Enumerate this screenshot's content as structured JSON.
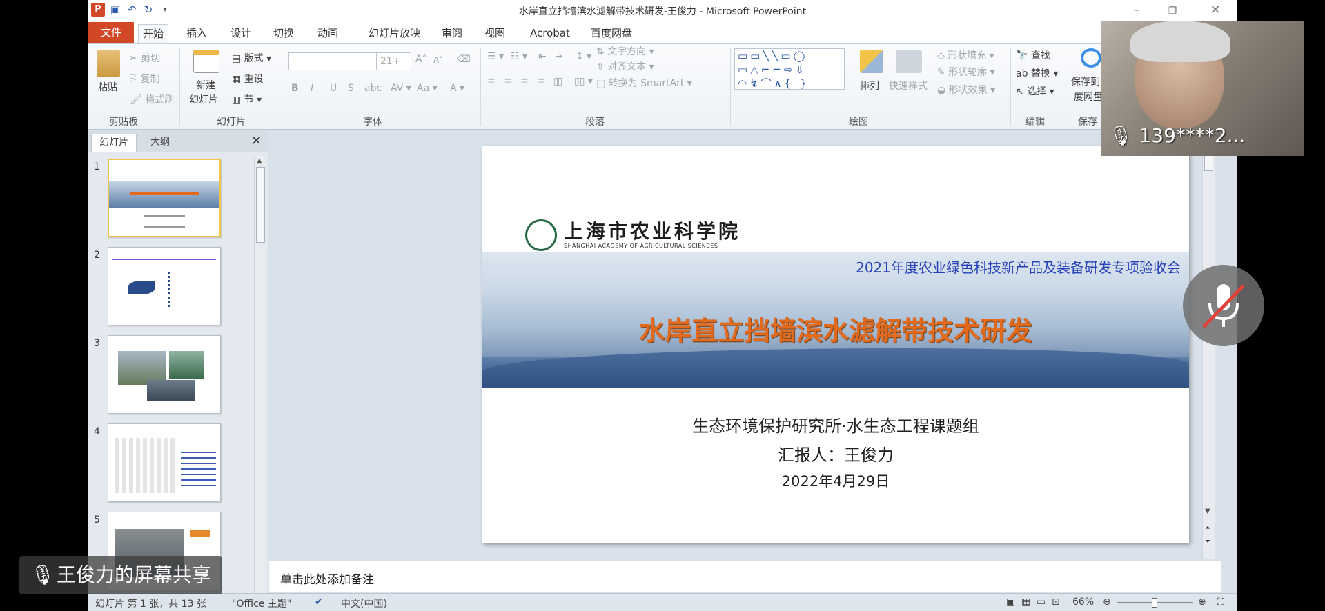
{
  "window": {
    "title": "水岸直立挡墙滨水滤解带技术研发-王俊力 - Microsoft PowerPoint"
  },
  "tabs": [
    "文件",
    "开始",
    "插入",
    "设计",
    "切换",
    "动画",
    "幻灯片放映",
    "审阅",
    "视图",
    "Acrobat",
    "百度网盘"
  ],
  "ribbon": {
    "clipboard": {
      "paste": "粘贴",
      "cut": "剪切",
      "copy": "复制",
      "format_painter": "格式刷",
      "label": "剪贴板"
    },
    "slides": {
      "new_slide_1": "新建",
      "new_slide_2": "幻灯片",
      "layout": "版式",
      "reset": "重设",
      "section": "节",
      "label": "幻灯片"
    },
    "font": {
      "size": "21+",
      "label": "字体"
    },
    "paragraph": {
      "text_direction": "文字方向",
      "align_text": "对齐文本",
      "convert_smartart": "转换为 SmartArt",
      "label": "段落"
    },
    "drawing": {
      "arrange": "排列",
      "quick_styles": "快速样式",
      "shape_fill": "形状填充",
      "shape_outline": "形状轮廓",
      "shape_effects": "形状效果",
      "label": "绘图"
    },
    "editing": {
      "find": "查找",
      "replace": "替换",
      "select": "选择",
      "label": "编辑"
    },
    "save": {
      "line1": "保存到",
      "line2": "度网盘",
      "label": "保存"
    }
  },
  "left_pane": {
    "tabs": [
      "幻灯片",
      "大纲"
    ],
    "thumb_numbers": [
      "1",
      "2",
      "3",
      "4",
      "5"
    ]
  },
  "slide": {
    "org_name": "上海市农业科学院",
    "org_name_en": "SHANGHAI ACADEMY OF AGRICULTURAL SCIENCES",
    "conference": "2021年度农业绿色科技新产品及装备研发专项验收会",
    "title": "水岸直立挡墙滨水滤解带技术研发",
    "dept": "生态环境保护研究所·水生态工程课题组",
    "reporter": "汇报人：王俊力",
    "date": "2022年4月29日"
  },
  "notes": {
    "placeholder": "单击此处添加备注"
  },
  "status": {
    "slide_info": "幻灯片 第 1 张，共 13 张",
    "theme": "\"Office 主题\"",
    "language": "中文(中国)",
    "zoom": "66%",
    "zoom_fraction": 0.5
  },
  "overlay": {
    "video_label": "139****2...",
    "share_label": "王俊力的屏幕共享"
  }
}
